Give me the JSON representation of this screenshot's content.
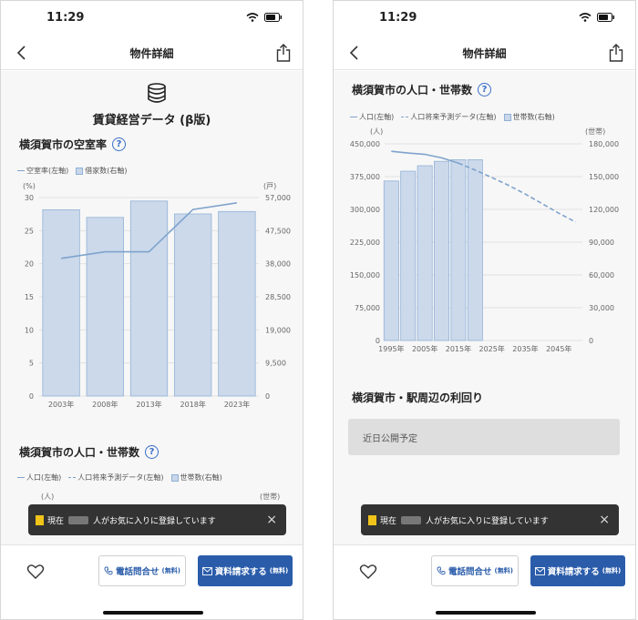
{
  "status": {
    "time": "11:29"
  },
  "nav": {
    "title": "物件詳細"
  },
  "left": {
    "header_title": "賃貸経営データ (β版)",
    "vacancy": {
      "title": "横須賀市の空室率",
      "legend_line": "空室率(左軸)",
      "legend_bar": "借家数(右軸)"
    },
    "pop_title": "横須賀市の人口・世帯数",
    "pop_legend_line": "人口(左軸)",
    "pop_legend_dash": "人口将来予測データ(左軸)",
    "pop_legend_bar": "世帯数(右軸)",
    "pop_unit_left": "(人)",
    "pop_unit_right": "(世帯)"
  },
  "right": {
    "pop_title": "横須賀市の人口・世帯数",
    "yield_title": "横須賀市・駅周辺の利回り",
    "coming_soon": "近日公開予定"
  },
  "toast": {
    "prefix": "現在",
    "suffix": "人がお気に入りに登録しています",
    "close": "×"
  },
  "actions": {
    "tel_label": "電話問合せ",
    "tel_note": "(無料)",
    "request_label": "資料請求する",
    "request_note": "(無料)"
  },
  "chart_data": [
    {
      "type": "bar",
      "title": "横須賀市の空室率",
      "categories": [
        "2003年",
        "2008年",
        "2013年",
        "2018年",
        "2023年"
      ],
      "series": [
        {
          "name": "借家数(右軸)",
          "axis": "right",
          "type": "bar",
          "values": [
            53500,
            51300,
            56000,
            52300,
            53000
          ]
        },
        {
          "name": "空室率(左軸)",
          "axis": "left",
          "type": "line",
          "values": [
            20.8,
            21.8,
            21.8,
            28.2,
            29.2
          ]
        }
      ],
      "y_left": {
        "unit": "(%)",
        "min": 0,
        "max": 30,
        "ticks": [
          0,
          5,
          10,
          15,
          20,
          25,
          30
        ]
      },
      "y_right": {
        "unit": "(戸)",
        "min": 0,
        "max": 57000,
        "ticks": [
          "0",
          "9,500",
          "19,000",
          "28,500",
          "38,000",
          "47,500",
          "57,000"
        ]
      }
    },
    {
      "type": "bar",
      "title": "横須賀市の人口・世帯数",
      "x_ticks": [
        "1995年",
        "2005年",
        "2015年",
        "2025年",
        "2035年",
        "2045年"
      ],
      "series": [
        {
          "name": "世帯数(右軸)",
          "axis": "right",
          "type": "bar",
          "x": [
            1995,
            2000,
            2005,
            2010,
            2015,
            2020
          ],
          "values": [
            146000,
            155000,
            160000,
            164000,
            165500,
            165500
          ]
        },
        {
          "name": "人口(左軸)",
          "axis": "left",
          "type": "line",
          "x": [
            1995,
            2000,
            2005,
            2010,
            2015
          ],
          "values": [
            433000,
            429000,
            426000,
            418000,
            406000
          ]
        },
        {
          "name": "人口将来予測データ(左軸)",
          "axis": "left",
          "type": "line-dashed",
          "x": [
            2015,
            2020,
            2025,
            2030,
            2035,
            2040,
            2045,
            2050
          ],
          "values": [
            406000,
            390000,
            373000,
            355000,
            335000,
            313000,
            291000,
            271000
          ]
        }
      ],
      "x_range": [
        1993,
        2052
      ],
      "y_left": {
        "unit": "(人)",
        "min": 0,
        "max": 450000,
        "ticks": [
          "0",
          "75,000",
          "150,000",
          "225,000",
          "300,000",
          "375,000",
          "450,000"
        ]
      },
      "y_right": {
        "unit": "(世帯)",
        "min": 0,
        "max": 180000,
        "ticks": [
          "0",
          "30,000",
          "60,000",
          "90,000",
          "120,000",
          "150,000",
          "180,000"
        ]
      }
    }
  ]
}
